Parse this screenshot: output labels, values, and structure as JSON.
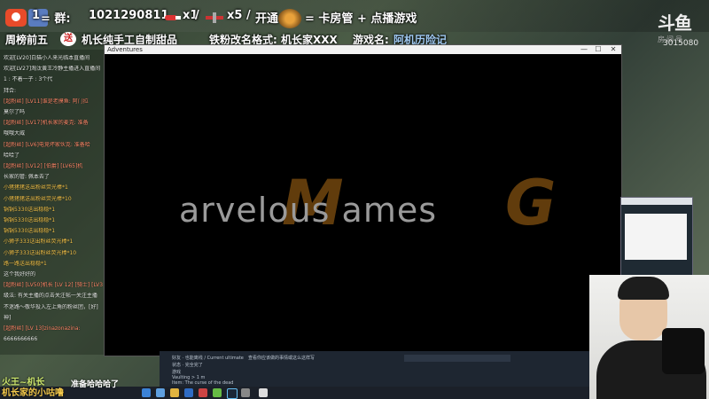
{
  "overlay": {
    "qq_label": "QQ群：",
    "qq_prefix": "1",
    "qq_group": "1021290811",
    "rocket_count": "x1",
    "plane_count": "x5",
    "open_label": "开通",
    "badge_text": "= 卡房管 + 点播游戏",
    "line2": {
      "rank": "周榜前五",
      "send": "送",
      "gift": "机长纯手工自制甜品",
      "rename_rule": "铁粉改名格式: 机长家XXX",
      "game_label": "游戏名:",
      "game_name": "阿机历险记"
    }
  },
  "logo": {
    "mark": "斗鱼",
    "sub": "房间号",
    "room_id": "3015080"
  },
  "chat": {
    "lines": [
      {
        "text": "欢迎[LV20]白猫小人来光临本直播间",
        "kind": "normal"
      },
      {
        "text": "欢迎[LV27]淘汰黄王冷静主播进入直播间",
        "kind": "normal"
      },
      {
        "text": "1 : 不着一子 : 3个代",
        "kind": "normal"
      },
      {
        "text": "拜合:",
        "kind": "normal"
      },
      {
        "text": "[超粉丝] [LV11]谁是老摸鱼: 阿门拉",
        "kind": "vip"
      },
      {
        "text": "莫尔了吗",
        "kind": "normal"
      },
      {
        "text": "[超粉丝] [LV17]机长家的麦克: 准备",
        "kind": "vip"
      },
      {
        "text": "哦哦大威",
        "kind": "normal"
      },
      {
        "text": "[超粉丝] [LV6]电竞坏家伙克: 准备哈",
        "kind": "vip"
      },
      {
        "text": "哈哈了",
        "kind": "normal"
      },
      {
        "text": "[超粉丝] [LV12] [伯爵] [LV65]机",
        "kind": "vip"
      },
      {
        "text": "长家的管: 佩本去了",
        "kind": "normal"
      },
      {
        "text": "小猪猪猪送出粉丝荧光棒*1",
        "kind": "gift"
      },
      {
        "text": "小猪猪猪送出粉丝荧光棒*10",
        "kind": "gift"
      },
      {
        "text": "锅锅5330送出稳稳*1",
        "kind": "gift"
      },
      {
        "text": "锅锅5330送出稳稳*1",
        "kind": "gift"
      },
      {
        "text": "锅锅5330送出稳稳*1",
        "kind": "gift"
      },
      {
        "text": "小狮子333送出粉丝荧光棒*1",
        "kind": "gift"
      },
      {
        "text": "小狮子333送出粉丝荧光棒*10",
        "kind": "gift"
      },
      {
        "text": "路一路送出稳稳*1",
        "kind": "gift"
      },
      {
        "text": "这个我好好的",
        "kind": "normal"
      },
      {
        "text": "[超粉丝] [LV50]机长 [LV 12] [骑士] [LV36]要穿！",
        "kind": "vip"
      },
      {
        "text": "级法: 有关主播的点击关注帖一关注主播",
        "kind": "normal"
      },
      {
        "text": "不迷路～敬华投入左上角的粉丝团，[好]",
        "kind": "normal"
      },
      {
        "text": "神]",
        "kind": "normal"
      },
      {
        "text": "[超粉丝] [LV 13]zinazonazina:",
        "kind": "vip"
      },
      {
        "text": "6666666666",
        "kind": "normal"
      }
    ]
  },
  "game": {
    "window_title": "Adventures",
    "splash_text": "arvelous ames",
    "minimize": "—",
    "maximize": "☐",
    "close": "✕"
  },
  "steam": {
    "items": [
      "好友 · 也能离线 / Current ultimate",
      "状态 · 完全完了",
      "游戏",
      "Vaulting > 1 m",
      "Item: The curse of the dead",
      "查看你应该做的事情或这么这样写"
    ]
  },
  "viewer": {
    "name": "火王~机长",
    "level_text": "准备哈哈哈了",
    "fan": "机长家的小咕噜"
  }
}
